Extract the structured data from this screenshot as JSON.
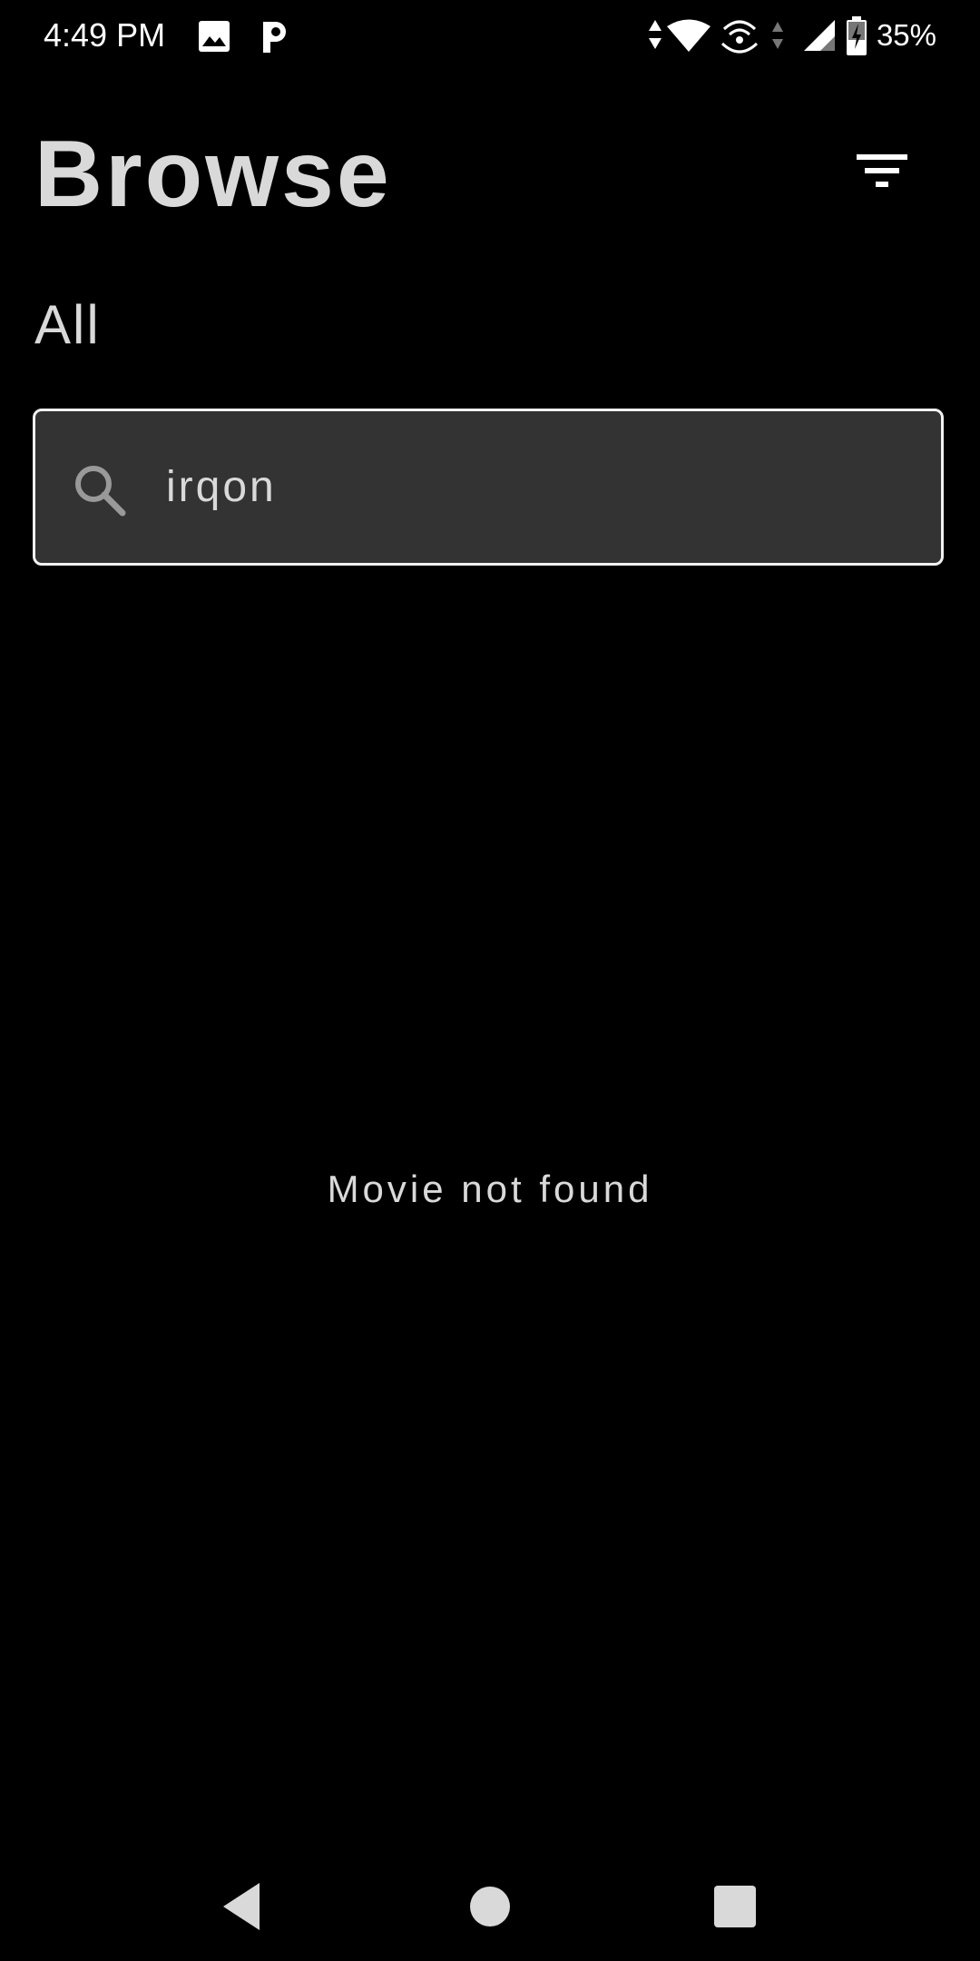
{
  "status_bar": {
    "time": "4:49 PM",
    "battery_percent": "35%",
    "icons": [
      "image-notification-icon",
      "p-app-notification-icon",
      "data-arrows-icon",
      "wifi-icon",
      "hotspot-icon",
      "cell-signal-icon",
      "battery-charging-icon"
    ]
  },
  "header": {
    "title": "Browse",
    "filter_icon": "filter-icon"
  },
  "category": {
    "label": "All"
  },
  "search": {
    "value": "irqon",
    "icon": "search-icon"
  },
  "results": {
    "empty_message": "Movie not found"
  },
  "navigation": {
    "buttons": [
      "back-icon",
      "home-icon",
      "recents-icon"
    ]
  },
  "colors": {
    "background": "#000000",
    "text": "#d9d9d9",
    "search_background": "#333333",
    "search_border": "#f2f2f2"
  }
}
